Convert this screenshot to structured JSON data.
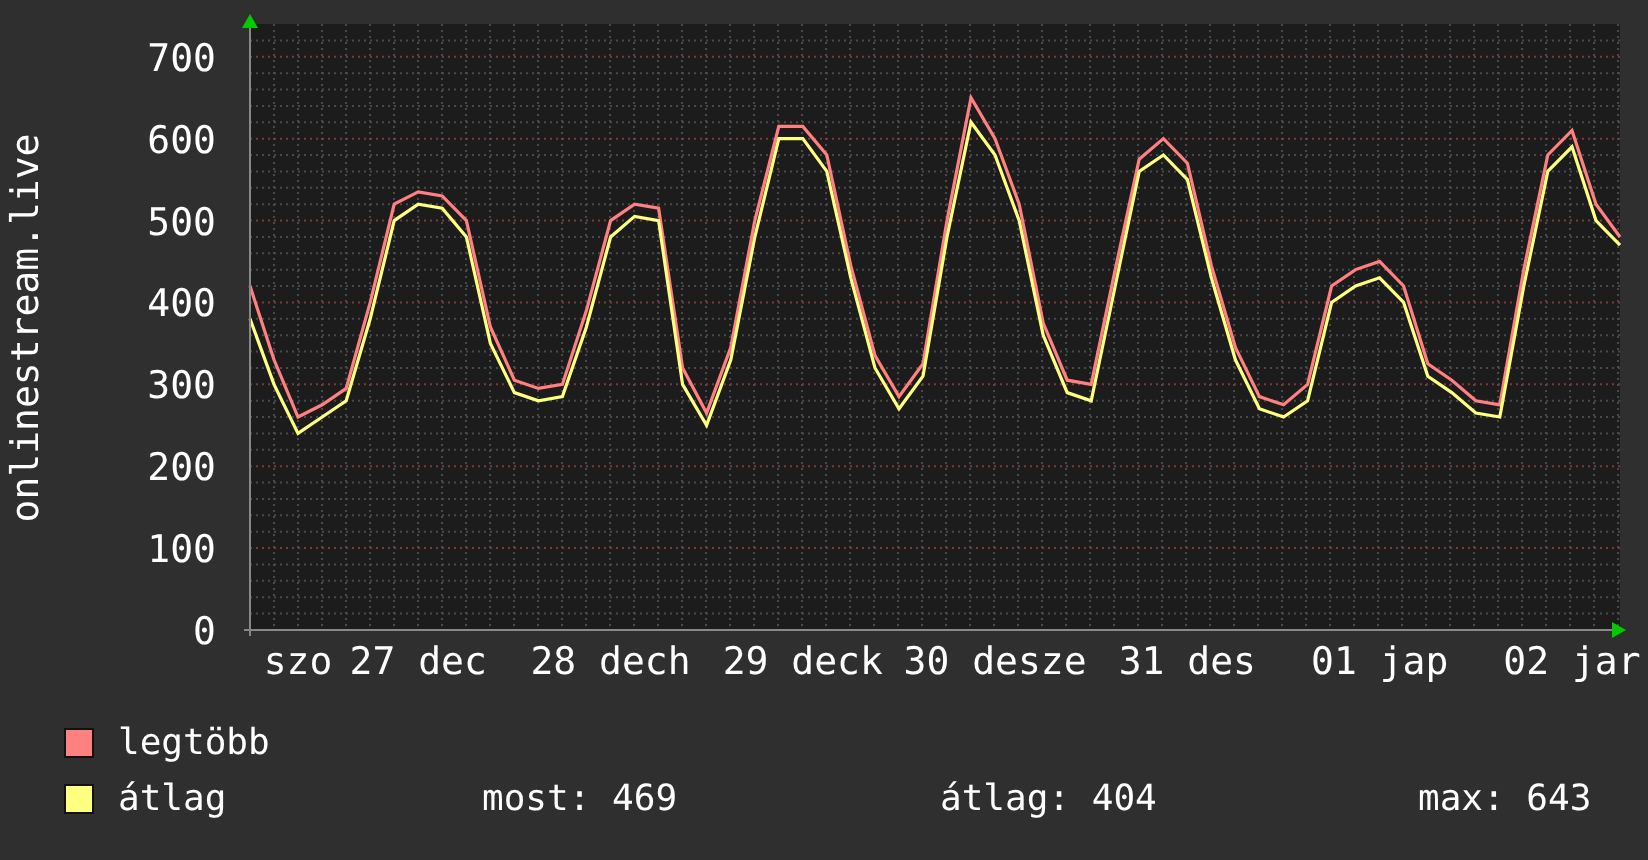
{
  "chart_data": {
    "type": "line",
    "ylabel": "onlinestream.live",
    "grid": true,
    "categories": [
      null,
      null,
      "szo",
      null,
      null,
      null,
      null,
      "27 dec",
      null,
      null,
      null,
      null,
      null,
      null,
      null,
      "28 dech",
      null,
      null,
      null,
      null,
      null,
      null,
      null,
      "29 deck",
      null,
      null,
      null,
      null,
      null,
      null,
      null,
      "30 desze",
      null,
      null,
      null,
      null,
      null,
      null,
      null,
      "31 des",
      null,
      null,
      null,
      null,
      null,
      null,
      null,
      "01 jap",
      null,
      null,
      null,
      null,
      null,
      null,
      null,
      "02 jar",
      null,
      null
    ],
    "ylim": [
      0,
      740
    ],
    "yticks": [
      0,
      100,
      200,
      300,
      400,
      500,
      600,
      700
    ],
    "series": [
      {
        "name": "legtöbb",
        "color": "#ff8080",
        "values": [
          420,
          330,
          260,
          275,
          295,
          400,
          520,
          535,
          530,
          500,
          370,
          305,
          295,
          300,
          390,
          500,
          520,
          515,
          320,
          265,
          345,
          500,
          615,
          615,
          580,
          445,
          335,
          285,
          325,
          500,
          650,
          600,
          520,
          375,
          305,
          300,
          440,
          575,
          600,
          570,
          445,
          345,
          285,
          275,
          300,
          420,
          440,
          450,
          420,
          325,
          305,
          280,
          275,
          440,
          580,
          610,
          520,
          480
        ]
      },
      {
        "name": "átlag",
        "color": "#ffff80",
        "values": [
          380,
          300,
          240,
          260,
          280,
          380,
          500,
          520,
          515,
          480,
          350,
          290,
          280,
          285,
          370,
          480,
          505,
          500,
          300,
          250,
          330,
          480,
          600,
          600,
          560,
          430,
          320,
          270,
          310,
          480,
          620,
          580,
          500,
          360,
          290,
          280,
          420,
          560,
          580,
          550,
          430,
          330,
          270,
          260,
          280,
          400,
          420,
          430,
          400,
          310,
          290,
          265,
          260,
          420,
          560,
          590,
          500,
          470
        ]
      }
    ]
  },
  "stats": [
    "most: 469",
    "átlag: 404",
    "max: 643"
  ]
}
